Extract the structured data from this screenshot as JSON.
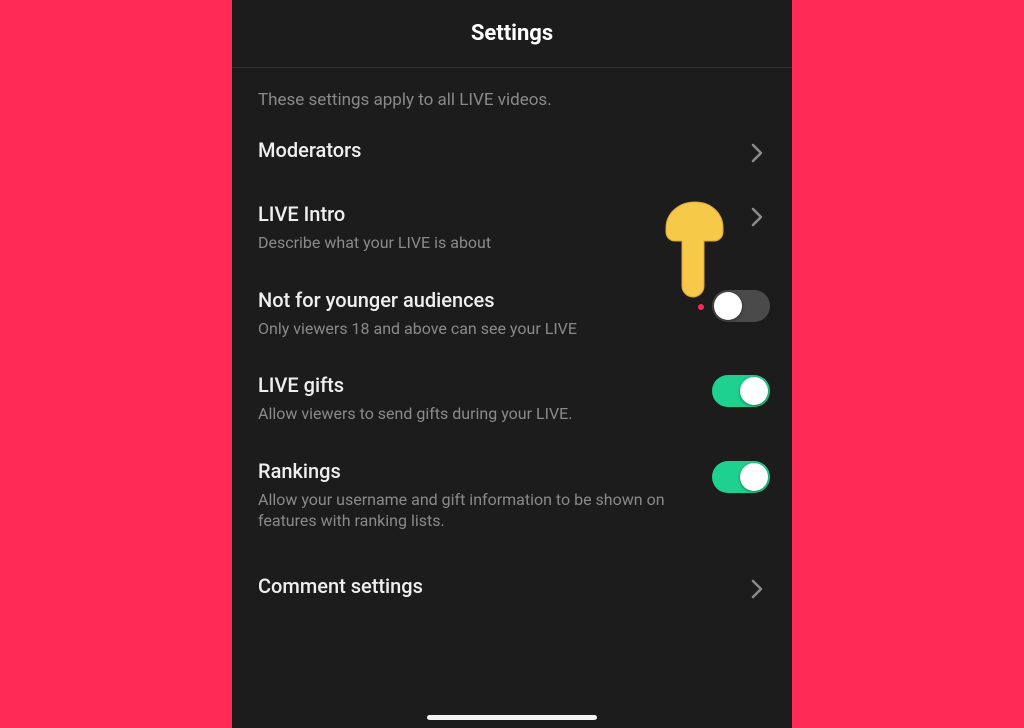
{
  "header": {
    "title": "Settings"
  },
  "intro": "These settings apply to all LIVE videos.",
  "rows": {
    "moderators": {
      "title": "Moderators",
      "sub": ""
    },
    "live_intro": {
      "title": "LIVE Intro",
      "sub": "Describe what your LIVE is about"
    },
    "not_for_younger": {
      "title": "Not for younger audiences",
      "sub": "Only viewers 18 and above can see your LIVE",
      "toggle": false
    },
    "live_gifts": {
      "title": "LIVE gifts",
      "sub": "Allow viewers to send gifts during your LIVE.",
      "toggle": true
    },
    "rankings": {
      "title": "Rankings",
      "sub": "Allow your username and gift information to be shown on features with ranking lists.",
      "toggle": true
    },
    "comment_settings": {
      "title": "Comment settings",
      "sub": ""
    }
  },
  "colors": {
    "accent": "#1fd18e",
    "bg_page": "#ff2a55",
    "bg_panel": "#1c1c1c"
  }
}
